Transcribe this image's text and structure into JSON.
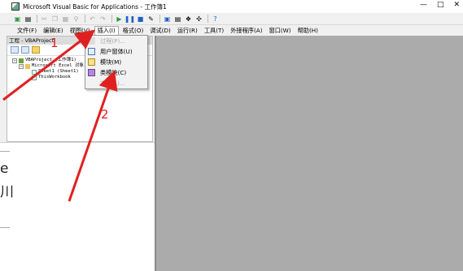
{
  "window": {
    "title": "Microsoft Visual Basic for Applications - 工作簿1",
    "controls": [
      "—",
      "□",
      "✕"
    ]
  },
  "toolbar": {
    "icons": [
      "excel-icon",
      "save-icon",
      "sep",
      "cut-icon",
      "copy-icon",
      "paste-icon",
      "find-icon",
      "sep",
      "undo-icon",
      "redo-icon",
      "sep",
      "run-icon",
      "break-icon",
      "reset-icon",
      "design-mode-icon",
      "sep",
      "project-explorer-icon",
      "properties-icon",
      "object-browser-icon",
      "toolbox-icon",
      "sep",
      "help-icon"
    ]
  },
  "menubar": {
    "items": [
      {
        "label": "文件(F)"
      },
      {
        "label": "编辑(E)"
      },
      {
        "label": "视图(V)"
      },
      {
        "label": "插入(I)",
        "active": true
      },
      {
        "label": "格式(O)"
      },
      {
        "label": "调试(D)"
      },
      {
        "label": "运行(R)"
      },
      {
        "label": "工具(T)"
      },
      {
        "label": "外接程序(A)"
      },
      {
        "label": "窗口(W)"
      },
      {
        "label": "帮助(H)"
      }
    ]
  },
  "project_pane": {
    "title": "工程 - VBAProject",
    "tree": [
      {
        "label": "VBAProject (工作簿1)",
        "level": 0,
        "expander": "−"
      },
      {
        "label": "Microsoft Excel 对象",
        "level": 1,
        "expander": "−"
      },
      {
        "label": "Sheet1 (Sheet1)",
        "level": 2
      },
      {
        "label": "ThisWorkbook",
        "level": 2
      }
    ]
  },
  "insert_menu": {
    "items": [
      {
        "label": "过程(P)...",
        "disabled": true,
        "icon": "procedure-icon"
      },
      {
        "label": "用户窗体(U)",
        "disabled": false,
        "icon": "userform-icon"
      },
      {
        "label": "模块(M)",
        "disabled": false,
        "icon": "module-icon"
      },
      {
        "label": "类模块(C)",
        "disabled": false,
        "icon": "class-module-icon"
      },
      {
        "label": "文件(L)...",
        "disabled": true,
        "icon": ""
      }
    ]
  },
  "background_excel": {
    "fragments": [
      "e",
      "川"
    ]
  },
  "annotations": {
    "color": "#e02020",
    "labels": [
      "1",
      "2"
    ]
  }
}
